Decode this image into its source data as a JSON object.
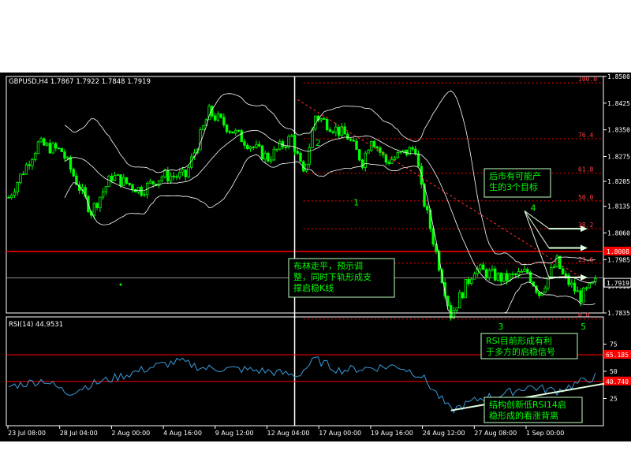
{
  "colors": {
    "background": "#000000",
    "frame": "#ffffff",
    "candle": "#00ff00",
    "bands": "#ffffff",
    "rsi_line": "#3a9ad9",
    "red_line": "#ff0000",
    "fib_line": "#ff0000",
    "fib_label": "#ff4040",
    "note_text": "#00ff00",
    "note_border": "#c0ffc0",
    "arrow": "#e0ffe0",
    "wave_label": "#00ff00"
  },
  "header": {
    "main_title": "GBPUSD,H4  1.7867 1.7922 1.7848 1.7919",
    "rsi_title": "RSI(14)  44.9531"
  },
  "notes": {
    "bollinger": "布林走平，预示调\n整，同时下轨形成支\n撑启稳K线",
    "targets": "后市有可能产\n生的3个目标",
    "rsi_signal": "RSI目前形成有利\n于多方的启稳信号",
    "divergence": "结构创新低RSI14启\n稳形成的看涨背离"
  },
  "wave_labels": [
    {
      "text": "2",
      "x": 104,
      "y": 1.8305
    },
    {
      "text": "1",
      "x": 117,
      "y": 1.8138
    },
    {
      "text": "4",
      "x": 177,
      "y": 1.8122
    },
    {
      "text": "3",
      "x": 166,
      "y": 76
    },
    {
      "text": "5",
      "x": 194,
      "y": 76
    }
  ],
  "chart_data": {
    "type": "candlestick",
    "time_ticks": [
      "23 Jul 08:00",
      "28 Jul 04:00",
      "2 Aug 00:00",
      "4 Aug 16:00",
      "9 Aug 12:00",
      "12 Aug 04:00",
      "17 Aug 00:00",
      "19 Aug 16:00",
      "24 Aug 12:00",
      "27 Aug 08:00",
      "1 Sep 00:00"
    ],
    "price_axis": {
      "ylim": [
        1.7835,
        1.85
      ],
      "ticks": [
        "1.8500",
        "1.8425",
        "1.8350",
        "1.8275",
        "1.8205",
        "1.8135",
        "1.8060",
        "1.7985",
        "1.7910",
        "1.7835"
      ],
      "highlight_ticks": [
        {
          "value": 1.8008,
          "label": "1.8008",
          "color": "#ff0000"
        },
        {
          "value": 1.7919,
          "label": "1.7919",
          "color": "#ffffff"
        }
      ]
    },
    "horizontal_lines": [
      {
        "value": 1.8008,
        "color": "#ff0000"
      },
      {
        "value": 1.7934,
        "color": "#bbbbbb"
      }
    ],
    "fibonacci": {
      "levels": [
        {
          "label": "100.0",
          "value": 1.8482
        },
        {
          "label": "76.4",
          "value": 1.8325
        },
        {
          "label": "61.8",
          "value": 1.8228
        },
        {
          "label": "50.0",
          "value": 1.815
        },
        {
          "label": "38.2",
          "value": 1.8072
        },
        {
          "label": "23.6",
          "value": 1.7975
        },
        {
          "label": "0.0",
          "value": 1.7818
        }
      ]
    },
    "candles": {
      "count": 200,
      "close_path": [
        [
          0,
          1.816
        ],
        [
          10,
          1.831
        ],
        [
          18,
          1.829
        ],
        [
          28,
          1.812
        ],
        [
          35,
          1.822
        ],
        [
          45,
          1.818
        ],
        [
          52,
          1.822
        ],
        [
          60,
          1.822
        ],
        [
          68,
          1.84
        ],
        [
          80,
          1.832
        ],
        [
          88,
          1.827
        ],
        [
          96,
          1.833
        ],
        [
          100,
          1.822
        ],
        [
          104,
          1.839
        ],
        [
          115,
          1.833
        ],
        [
          120,
          1.826
        ],
        [
          123,
          1.833
        ],
        [
          128,
          1.826
        ],
        [
          138,
          1.83
        ],
        [
          140,
          1.818
        ],
        [
          150,
          1.783
        ],
        [
          158,
          1.796
        ],
        [
          168,
          1.793
        ],
        [
          176,
          1.795
        ],
        [
          180,
          1.789
        ],
        [
          186,
          1.798
        ],
        [
          188,
          1.794
        ],
        [
          194,
          1.788
        ],
        [
          199,
          1.7919
        ]
      ],
      "volatility": 0.0018
    },
    "bollinger": {
      "period": 20,
      "deviations": 2
    },
    "rsi": {
      "title": "RSI(14)",
      "last_value": 44.9531,
      "ylim": [
        0,
        100
      ],
      "ticks": [
        75,
        50,
        25
      ],
      "levels": [
        {
          "value": 65.185,
          "label": "65.185"
        },
        {
          "value": 40.74,
          "label": "40.740"
        }
      ],
      "values_path": [
        [
          0,
          36
        ],
        [
          12,
          42
        ],
        [
          20,
          30
        ],
        [
          28,
          38
        ],
        [
          40,
          47
        ],
        [
          50,
          55
        ],
        [
          58,
          59
        ],
        [
          66,
          53
        ],
        [
          78,
          52
        ],
        [
          88,
          50
        ],
        [
          98,
          46
        ],
        [
          104,
          61
        ],
        [
          112,
          51
        ],
        [
          122,
          53
        ],
        [
          132,
          55
        ],
        [
          140,
          46
        ],
        [
          150,
          14
        ],
        [
          160,
          25
        ],
        [
          168,
          29
        ],
        [
          176,
          36
        ],
        [
          186,
          32
        ],
        [
          194,
          40
        ],
        [
          199,
          44.95
        ]
      ],
      "support_line": {
        "from": [
          150,
          14
        ],
        "to": [
          205,
          40
        ]
      }
    },
    "target_arrows": [
      {
        "from_x": 175,
        "from_y": 1.8122,
        "to_y": 1.8072
      },
      {
        "from_x": 175,
        "from_y": 1.8122,
        "to_y": 1.8018
      },
      {
        "from_x": 175,
        "from_y": 1.8122,
        "to_y": 1.7935
      }
    ],
    "trend_line": {
      "from": [
        98,
        1.8435
      ],
      "to": [
        196,
        1.7925
      ]
    }
  }
}
